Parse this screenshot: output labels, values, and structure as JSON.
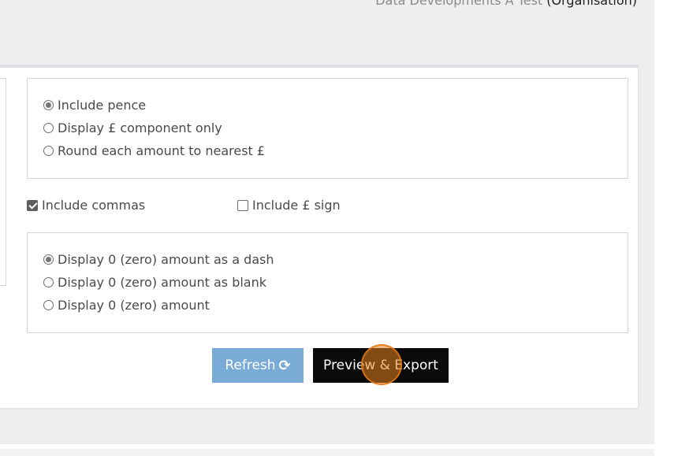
{
  "header": {
    "org_name": "Data Developments A Test",
    "org_type": "(Organisation)"
  },
  "pence_options": [
    {
      "label": "Include pence",
      "checked": true
    },
    {
      "label": "Display £ component only",
      "checked": false
    },
    {
      "label": "Round each amount to nearest £",
      "checked": false
    }
  ],
  "checkboxes": {
    "include_commas": {
      "label": "Include commas",
      "checked": true
    },
    "include_pound_sign": {
      "label": "Include £ sign",
      "checked": false
    }
  },
  "zero_options": [
    {
      "label": "Display 0 (zero) amount as a dash",
      "checked": true
    },
    {
      "label": "Display 0 (zero) amount as blank",
      "checked": false
    },
    {
      "label": "Display 0 (zero) amount",
      "checked": false
    }
  ],
  "buttons": {
    "refresh_label": "Refresh",
    "refresh_icon": "refresh-icon",
    "preview_label": "Preview & Export"
  },
  "colors": {
    "refresh_button": "#7aaad6",
    "preview_button": "#0b0b0b",
    "click_indicator": "#e8821e"
  }
}
